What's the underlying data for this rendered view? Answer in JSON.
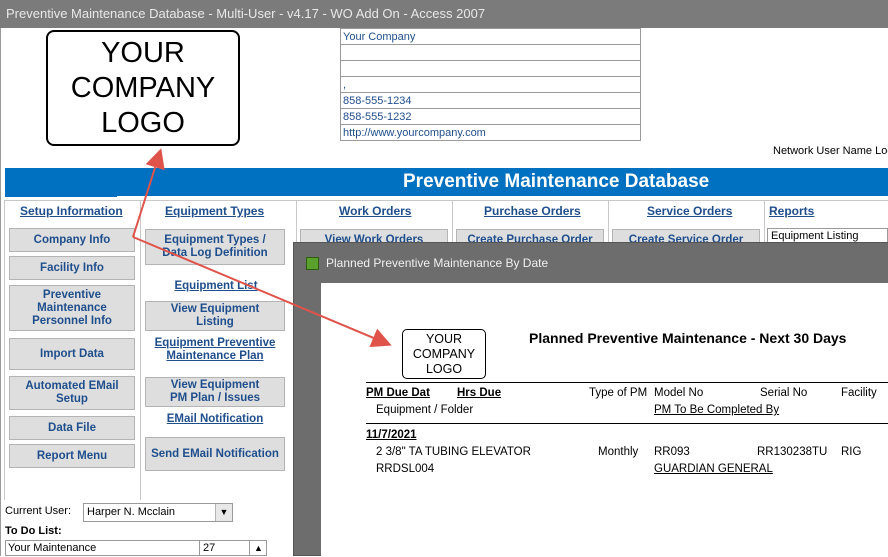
{
  "window_title": "Preventive Maintenance Database - Multi-User - v4.17 - WO Add On - Access 2007",
  "logo_text": [
    "YOUR",
    "COMPANY",
    "LOGO"
  ],
  "company_info": [
    "Your Company",
    "",
    "",
    ",",
    "858-555-1234",
    "858-555-1232",
    "http://www.yourcompany.com"
  ],
  "network_user_label": "Network User Name Log",
  "banner_title": "Preventive Maintenance Database",
  "menu": {
    "setup": {
      "header": "Setup Information",
      "buttons": [
        "Company Info",
        "Facility Info",
        "Preventive Maintenance Personnel Info",
        "Import Data",
        "Automated EMail Setup",
        "Data File",
        "Report Menu"
      ]
    },
    "equipment": {
      "header": "Equipment Types",
      "types_button": "Equipment Types / Data Log Definition",
      "list_header": "Equipment List",
      "view_list_button": "View Equipment Listing",
      "pm_plan_header": "Equipment Preventive Maintenance Plan",
      "pm_plan_button": "View Equipment PM Plan / Issues",
      "email_header": "EMail Notification",
      "email_button": "Send EMail Notification"
    },
    "work_orders": {
      "header": "Work Orders",
      "button": "View Work Orders"
    },
    "purchase_orders": {
      "header": "Purchase Orders",
      "button": "Create Purchase Order"
    },
    "service_orders": {
      "header": "Service Orders",
      "button": "Create Service Order"
    },
    "reports": {
      "header": "Reports",
      "selected": "Equipment Listing"
    }
  },
  "current_user": {
    "label": "Current User:",
    "value": "Harper N. Mcclain"
  },
  "todo": {
    "label": "To Do List:",
    "row_name": "Your Maintenance",
    "row_count": "27"
  },
  "subwindow": {
    "title": "Planned Preventive Maintenance By Date",
    "logo_text": [
      "YOUR",
      "COMPANY",
      "LOGO"
    ],
    "report_title": "Planned Preventive Maintenance - Next 30 Days",
    "columns": {
      "pm_due": "PM Due Dat",
      "hrs_due": "Hrs Due",
      "type": "Type of PM",
      "model": "Model No",
      "serial": "Serial No",
      "facility": "Facility",
      "equipment": "Equipment / Folder",
      "to_be_completed": "PM To Be Completed By"
    },
    "record": {
      "date": "11/7/2021",
      "equipment": "2 3/8\" TA TUBING ELEVATOR",
      "type": "Monthly",
      "model": "RR093",
      "serial": "RR130238TU",
      "facility": "RIG",
      "folder": "RRDSL004",
      "completed_by": "GUARDIAN GENERAL"
    }
  },
  "colors": {
    "banner": "#0070c0",
    "link": "#1f4e8c",
    "annotation_arrow": "#e0534a",
    "subwindow_frame": "#6d6d6d"
  }
}
